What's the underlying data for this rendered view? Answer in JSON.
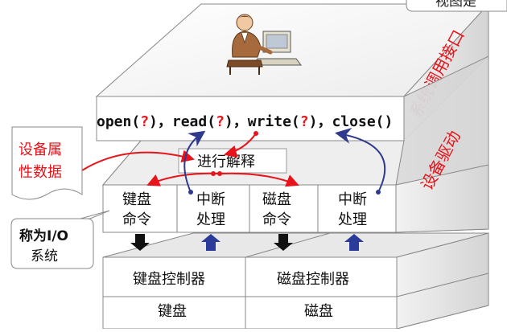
{
  "corner_label": "视图是",
  "layers": {
    "syscall_label": "系统调用接口",
    "driver_label": "设备驱动"
  },
  "calls": {
    "open": "open(",
    "read": "read(",
    "write": "write(",
    "close": "close()",
    "q": "?",
    "rp": ")",
    "sep": "，"
  },
  "interpret_label": "进行解释",
  "device_attr_note": [
    "设备属",
    "性数据"
  ],
  "io_system_note": [
    "称为I/O",
    "系统"
  ],
  "cells": [
    [
      "键盘",
      "命令"
    ],
    [
      "中断",
      "处理"
    ],
    [
      "磁盘",
      "命令"
    ],
    [
      "中断",
      "处理"
    ]
  ],
  "controllers": [
    "键盘控制器",
    "磁盘控制器"
  ],
  "devices": [
    "键盘",
    "磁盘"
  ],
  "colors": {
    "red_arrow": "#e8131b",
    "blue_arrow": "#2f3a8f",
    "up_arrow": "#2b3b9a",
    "down_arrow": "#111111",
    "label_red": "#e8131b",
    "box_face": "#ffffff",
    "slab_side": "#d9d9d9",
    "slab_dark": "#c4c4c4"
  }
}
